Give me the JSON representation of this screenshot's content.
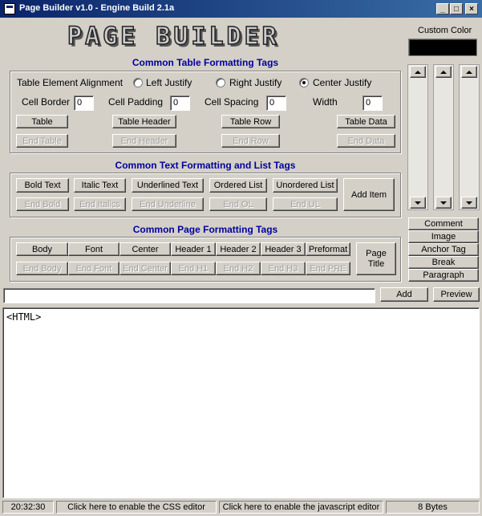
{
  "window": {
    "title": "Page Builder v1.0 - Engine Build 2.1a",
    "minimize": "_",
    "maximize": "□",
    "close": "×"
  },
  "logo": "PAGE BUILDER",
  "custom_color": {
    "label": "Custom Color",
    "value": "#000000"
  },
  "table_section": {
    "title": "Common Table Formatting Tags",
    "alignment_label": "Table Element Alignment",
    "radios": [
      {
        "label": "Left Justify",
        "checked": false
      },
      {
        "label": "Right Justify",
        "checked": false
      },
      {
        "label": "Center Justify",
        "checked": true
      }
    ],
    "fields": [
      {
        "label": "Cell Border",
        "value": "0"
      },
      {
        "label": "Cell Padding",
        "value": "0"
      },
      {
        "label": "Cell Spacing",
        "value": "0"
      },
      {
        "label": "Width",
        "value": "0"
      }
    ],
    "buttons": [
      "Table",
      "Table Header",
      "Table Row",
      "Table Data"
    ],
    "end_buttons": [
      "End Table",
      "End Header",
      "End Row",
      "End Data"
    ]
  },
  "text_section": {
    "title": "Common Text Formatting and List Tags",
    "buttons": [
      "Bold Text",
      "Italic Text",
      "Underlined Text",
      "Ordered List",
      "Unordered List"
    ],
    "end_buttons": [
      "End Bold",
      "End Italics",
      "End Underline",
      "End OL",
      "End UL"
    ],
    "add_item": "Add Item"
  },
  "page_section": {
    "title": "Common Page Formatting Tags",
    "buttons": [
      "Body",
      "Font",
      "Center",
      "Header 1",
      "Header 2",
      "Header 3",
      "Preformat"
    ],
    "end_buttons": [
      "End Body",
      "End Font",
      "End Center",
      "End H1",
      "End H2",
      "End H3",
      "End PRE"
    ],
    "page_title_line1": "Page",
    "page_title_line2": "Title"
  },
  "side_buttons": [
    "Comment",
    "Image",
    "Anchor Tag",
    "Break",
    "Paragraph"
  ],
  "input_bar": {
    "value": "",
    "add": "Add",
    "preview": "Preview"
  },
  "editor": {
    "content": "<HTML>"
  },
  "status": {
    "time": "20:32:30",
    "css": "Click here to enable the CSS editor",
    "js": "Click here to enable the javascript editor",
    "size": "8 Bytes"
  }
}
